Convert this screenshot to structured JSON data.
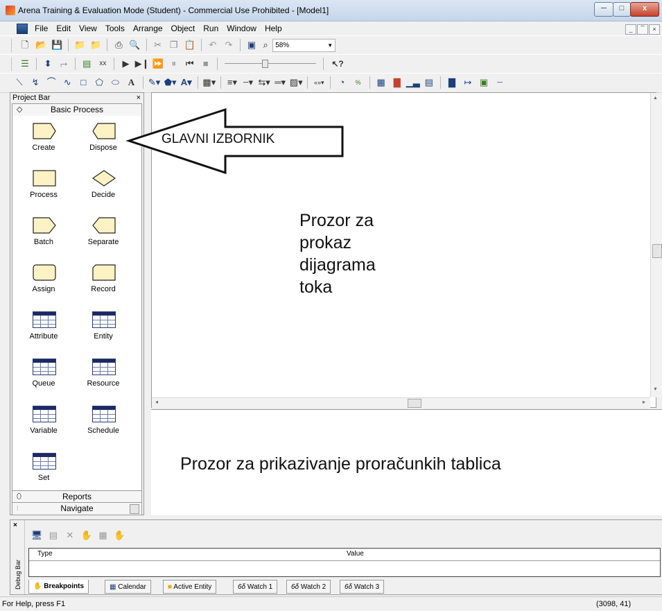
{
  "window": {
    "title": "Arena Training & Evaluation Mode (Student) - Commercial Use Prohibited - [Model1]",
    "minimize": "─",
    "maximize": "□",
    "close": "x"
  },
  "menu": [
    "File",
    "Edit",
    "View",
    "Tools",
    "Arrange",
    "Object",
    "Run",
    "Window",
    "Help"
  ],
  "mdi_controls": [
    "_",
    "̅",
    "×"
  ],
  "toolbar": {
    "zoom_value": "58%",
    "help_pointer": "↖?"
  },
  "project_bar": {
    "title": "Project Bar",
    "close": "×",
    "panel_title": "Basic Process",
    "modules": [
      {
        "label": "Create",
        "shape": "create"
      },
      {
        "label": "Dispose",
        "shape": "dispose"
      },
      {
        "label": "Process",
        "shape": "rect"
      },
      {
        "label": "Decide",
        "shape": "diamond"
      },
      {
        "label": "Batch",
        "shape": "batch"
      },
      {
        "label": "Separate",
        "shape": "separate"
      },
      {
        "label": "Assign",
        "shape": "rounded"
      },
      {
        "label": "Record",
        "shape": "record"
      },
      {
        "label": "Attribute",
        "shape": "table"
      },
      {
        "label": "Entity",
        "shape": "table"
      },
      {
        "label": "Queue",
        "shape": "table"
      },
      {
        "label": "Resource",
        "shape": "table"
      },
      {
        "label": "Variable",
        "shape": "table"
      },
      {
        "label": "Schedule",
        "shape": "table"
      },
      {
        "label": "Set",
        "shape": "table"
      }
    ],
    "reports_label": "Reports",
    "navigate_label": "Navigate"
  },
  "annotations": {
    "arrow_label": "GLAVNI IZBORNIK",
    "flowchart_label": [
      "Prozor za",
      "prokaz",
      "dijagrama",
      "toka"
    ],
    "spreadsheet_label": "Prozor za prikazivanje proračunkih tablica"
  },
  "debug_bar": {
    "side_label": "Debug Bar",
    "columns": {
      "type": "Type",
      "value": "Value"
    },
    "tabs": [
      "Breakpoints",
      "Calendar",
      "Active Entity",
      "Watch 1",
      "Watch 2",
      "Watch 3"
    ]
  },
  "status": {
    "help": "For Help, press F1",
    "coords": "(3098, 41)"
  },
  "colors": {
    "title_gradient_top": "#dbe6f3",
    "close_red": "#c6422c",
    "module_fill": "#fdf2c4",
    "table_header": "#1d2a66"
  }
}
